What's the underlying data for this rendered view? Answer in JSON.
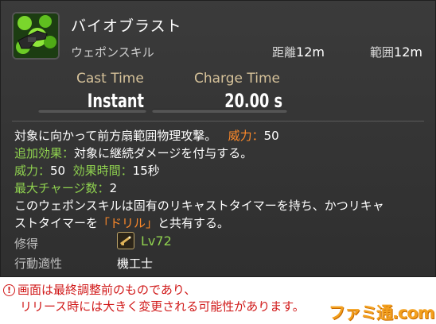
{
  "skill": {
    "name": "バイオブラスト",
    "type": "ウェポンスキル",
    "range_label": "距離",
    "range_value": "12m",
    "radius_label": "範囲",
    "radius_value": "12m",
    "cast_label": "Cast Time",
    "cast_value": "Instant",
    "recast_label": "Charge Time",
    "recast_value": "20.00 s"
  },
  "description": {
    "line1_text": "対象に向かって前方扇範囲物理攻撃。",
    "line1_potency_label": "威力：",
    "line1_potency_value": "50",
    "line2_label": "追加効果：",
    "line2_text": "対象に継続ダメージを付与する。",
    "line3_potency_label": "威力：",
    "line3_potency_value": "50",
    "line3_duration_label": "効果時間：",
    "line3_duration_value": "15秒",
    "line4_label": "最大チャージ数：",
    "line4_value": "2",
    "line5": "このウェポンスキルは固有のリキャストタイマーを持ち、かつリキャ",
    "line6_prefix": "ストタイマーを",
    "line6_highlight": "「ドリル」",
    "line6_suffix": "と共有する。"
  },
  "meta": {
    "acquired_label": "修得",
    "acquired_level": "Lv72",
    "job_label": "行動適性",
    "job_value": "機工士"
  },
  "notice": {
    "icon_name": "exclamation-circle-icon",
    "line1": "画面は最終調整前のものであり、",
    "line2": "リリース時には大きく変更される可能性があります。"
  },
  "watermark": "ファミ通.com",
  "colors": {
    "green_accent": "#8fd14f",
    "orange_accent": "#ff8a2a",
    "label_gold": "#d6c29a",
    "notice_red": "#d01818"
  }
}
